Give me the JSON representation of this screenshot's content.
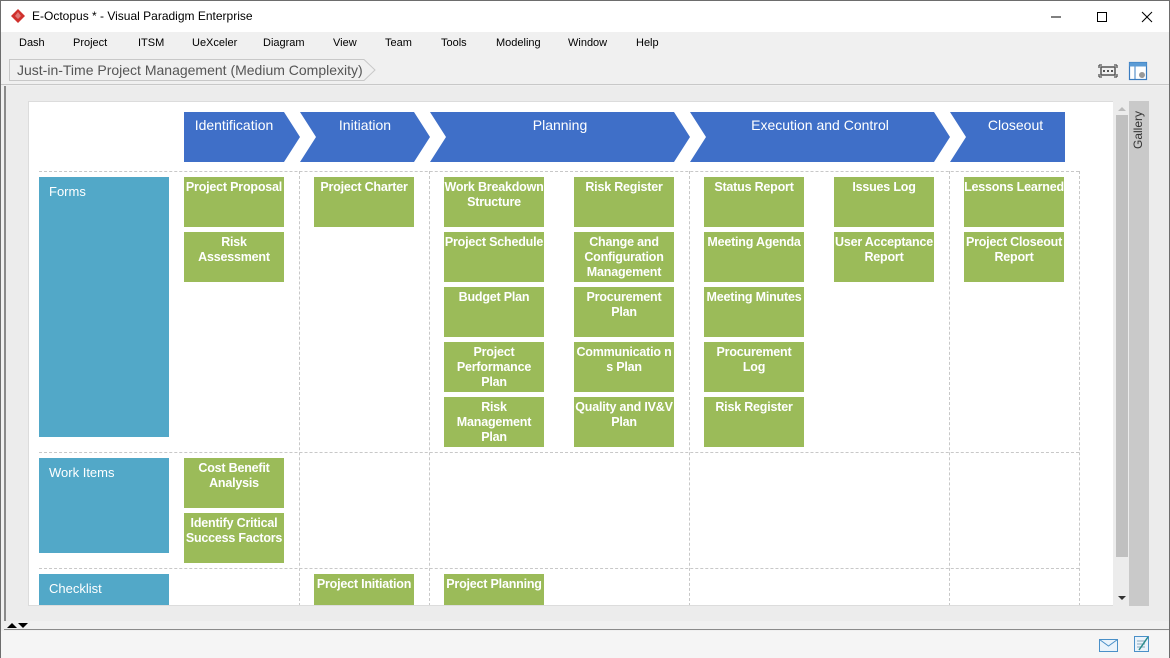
{
  "window": {
    "title": "E-Octopus * - Visual Paradigm Enterprise",
    "controls": [
      "minimize",
      "maximize",
      "close"
    ]
  },
  "menu": {
    "items": [
      "Dash",
      "Project",
      "ITSM",
      "UeXceler",
      "Diagram",
      "View",
      "Team",
      "Tools",
      "Modeling",
      "Window",
      "Help"
    ]
  },
  "breadcrumb": {
    "label": "Just-in-Time Project Management (Medium Complexity)"
  },
  "toolbar": {
    "icons": [
      "fit-diagram-icon",
      "layout-panel-icon"
    ]
  },
  "diagram": {
    "phases": [
      "Identification",
      "Initiation",
      "Planning",
      "Execution and Control",
      "Closeout"
    ],
    "rows": [
      {
        "label": "Forms",
        "cells": {
          "identification": [
            "Project Proposal",
            "Risk Assessment"
          ],
          "initiation": [
            "Project Charter"
          ],
          "planning_col1": [
            "Work Breakdown Structure",
            "Project Schedule",
            "Budget Plan",
            "Project Performance Plan",
            "Risk Management Plan"
          ],
          "planning_col2": [
            "Risk Register",
            "Change and Configuration Management",
            "Procurement Plan",
            "Communicatio ns Plan",
            "Quality and IV&V Plan"
          ],
          "execution_col1": [
            "Status Report",
            "Meeting Agenda",
            "Meeting Minutes",
            "Procurement Log",
            "Risk Register"
          ],
          "execution_col2": [
            "Issues Log",
            "User Acceptance Report"
          ],
          "closeout": [
            "Lessons Learned",
            "Project Closeout Report"
          ]
        }
      },
      {
        "label": "Work Items",
        "cells": {
          "identification": [
            "Cost Benefit Analysis",
            "Identify Critical Success Factors"
          ]
        }
      },
      {
        "label": "Checklist",
        "cells": {
          "initiation": [
            "Project Initiation"
          ],
          "planning_col1": [
            "Project Planning"
          ]
        }
      }
    ]
  },
  "side_panel": {
    "gallery_label": "Gallery"
  },
  "colors": {
    "phase": "#3f6fc8",
    "row_label": "#52a8c8",
    "card": "#9bbb59"
  },
  "statusbar": {
    "icons": [
      "mail-icon",
      "notes-icon"
    ]
  }
}
